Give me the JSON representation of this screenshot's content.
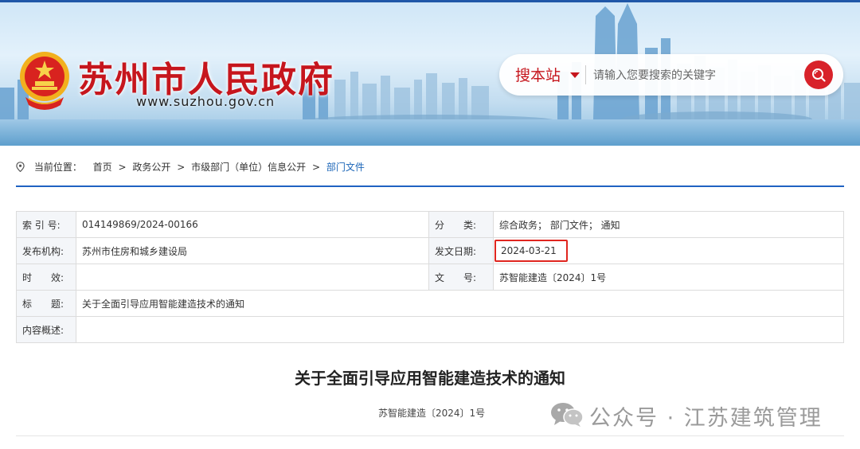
{
  "header": {
    "site_title": "苏州市人民政府",
    "site_url": "www.suzhou.gov.cn",
    "search": {
      "scope_label": "搜本站",
      "placeholder": "请输入您要搜索的关键字"
    }
  },
  "breadcrumb": {
    "prefix": "当前位置：",
    "items": [
      "首页",
      "政务公开",
      "市级部门（单位）信息公开",
      "部门文件"
    ],
    "separator": ">"
  },
  "info_table": {
    "index_label": "索 引 号:",
    "index_value": "014149869/2024-00166",
    "category_label": "分　　类:",
    "category_value": "综合政务； 部门文件； 通知",
    "publisher_label": "发布机构:",
    "publisher_value": "苏州市住房和城乡建设局",
    "date_label": "发文日期:",
    "date_value": "2024-03-21",
    "validity_label": "时　　效:",
    "validity_value": "",
    "doc_no_label": "文　　号:",
    "doc_no_value": "苏智能建造〔2024〕1号",
    "title_label": "标　　题:",
    "title_value": "关于全面引导应用智能建造技术的通知",
    "summary_label": "内容概述:",
    "summary_value": ""
  },
  "document": {
    "title": "关于全面引导应用智能建造技术的通知",
    "number": "苏智能建造〔2024〕1号"
  },
  "watermark": {
    "text": "公众号 · 江苏建筑管理"
  },
  "colors": {
    "brand_red": "#c6161d",
    "link_blue": "#1c66b8",
    "rule_blue": "#1f62c2",
    "highlight_red": "#e0261f"
  }
}
